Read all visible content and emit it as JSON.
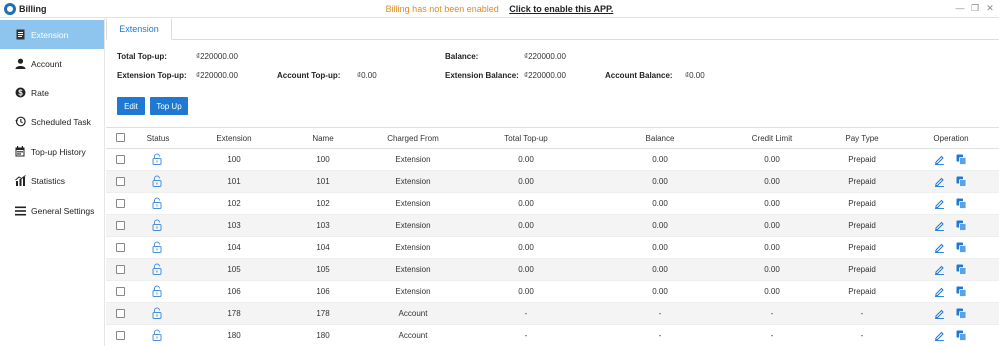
{
  "app": {
    "title": "Billing"
  },
  "notice": {
    "text": "Billing has not been enabled",
    "link": "Click to enable this APP."
  },
  "sidebar": {
    "items": [
      {
        "label": "Extension",
        "icon": "file-icon"
      },
      {
        "label": "Account",
        "icon": "user-icon"
      },
      {
        "label": "Rate",
        "icon": "dollar-icon"
      },
      {
        "label": "Scheduled Task",
        "icon": "clock-history-icon"
      },
      {
        "label": "Top-up History",
        "icon": "calendar-icon"
      },
      {
        "label": "Statistics",
        "icon": "bar-chart-icon"
      },
      {
        "label": "General Settings",
        "icon": "menu-icon"
      }
    ],
    "active": 0
  },
  "tabs": {
    "extension": "Extension"
  },
  "summary": {
    "total_topup_label": "Total Top-up:",
    "total_topup_value": "₫220000.00",
    "balance_label": "Balance:",
    "balance_value": "₫220000.00",
    "extension_topup_label": "Extension Top-up:",
    "extension_topup_value": "₫220000.00",
    "account_topup_label": "Account Top-up:",
    "account_topup_value": "₫0.00",
    "extension_balance_label": "Extension Balance:",
    "extension_balance_value": "₫220000.00",
    "account_balance_label": "Account Balance:",
    "account_balance_value": "₫0.00"
  },
  "buttons": {
    "edit": "Edit",
    "topup": "Top Up"
  },
  "table": {
    "columns": [
      "Status",
      "Extension",
      "Name",
      "Charged From",
      "Total Top-up",
      "Balance",
      "Credit Limit",
      "Pay Type",
      "Operation"
    ],
    "rows": [
      {
        "extension": "100",
        "name": "100",
        "charged_from": "Extension",
        "total_topup": "0.00",
        "balance": "0.00",
        "credit_limit": "0.00",
        "pay_type": "Prepaid"
      },
      {
        "extension": "101",
        "name": "101",
        "charged_from": "Extension",
        "total_topup": "0.00",
        "balance": "0.00",
        "credit_limit": "0.00",
        "pay_type": "Prepaid"
      },
      {
        "extension": "102",
        "name": "102",
        "charged_from": "Extension",
        "total_topup": "0.00",
        "balance": "0.00",
        "credit_limit": "0.00",
        "pay_type": "Prepaid"
      },
      {
        "extension": "103",
        "name": "103",
        "charged_from": "Extension",
        "total_topup": "0.00",
        "balance": "0.00",
        "credit_limit": "0.00",
        "pay_type": "Prepaid"
      },
      {
        "extension": "104",
        "name": "104",
        "charged_from": "Extension",
        "total_topup": "0.00",
        "balance": "0.00",
        "credit_limit": "0.00",
        "pay_type": "Prepaid"
      },
      {
        "extension": "105",
        "name": "105",
        "charged_from": "Extension",
        "total_topup": "0.00",
        "balance": "0.00",
        "credit_limit": "0.00",
        "pay_type": "Prepaid"
      },
      {
        "extension": "106",
        "name": "106",
        "charged_from": "Extension",
        "total_topup": "0.00",
        "balance": "0.00",
        "credit_limit": "0.00",
        "pay_type": "Prepaid"
      },
      {
        "extension": "178",
        "name": "178",
        "charged_from": "Account",
        "total_topup": "-",
        "balance": "-",
        "credit_limit": "-",
        "pay_type": "-"
      },
      {
        "extension": "180",
        "name": "180",
        "charged_from": "Account",
        "total_topup": "-",
        "balance": "-",
        "credit_limit": "-",
        "pay_type": "-"
      }
    ]
  },
  "colors": {
    "accent": "#1f78d1",
    "sidebar_active": "#8ec5ee",
    "notice": "#e08a1e",
    "row_alt": "#f4f4f4"
  }
}
